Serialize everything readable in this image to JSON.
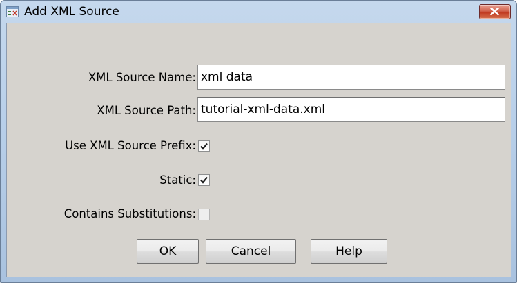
{
  "window": {
    "title": "Add XML Source",
    "close_label": "Close"
  },
  "form": {
    "name_label": "XML Source Name:",
    "name_value": "xml data",
    "path_label": "XML Source Path:",
    "path_value": "tutorial-xml-data.xml",
    "prefix_label": "Use XML Source Prefix:",
    "prefix_checked": true,
    "static_label": "Static:",
    "static_checked": true,
    "substitutions_label": "Contains Substitutions:",
    "substitutions_checked": false
  },
  "buttons": {
    "ok": "OK",
    "cancel": "Cancel",
    "help": "Help"
  },
  "colors": {
    "client_bg": "#d6d3ce",
    "title_bg": "#b9d0ea",
    "close_red": "#c0391f"
  },
  "icons": {
    "app": "xml-source-icon",
    "close": "close-x-icon",
    "check": "checkmark-icon"
  }
}
